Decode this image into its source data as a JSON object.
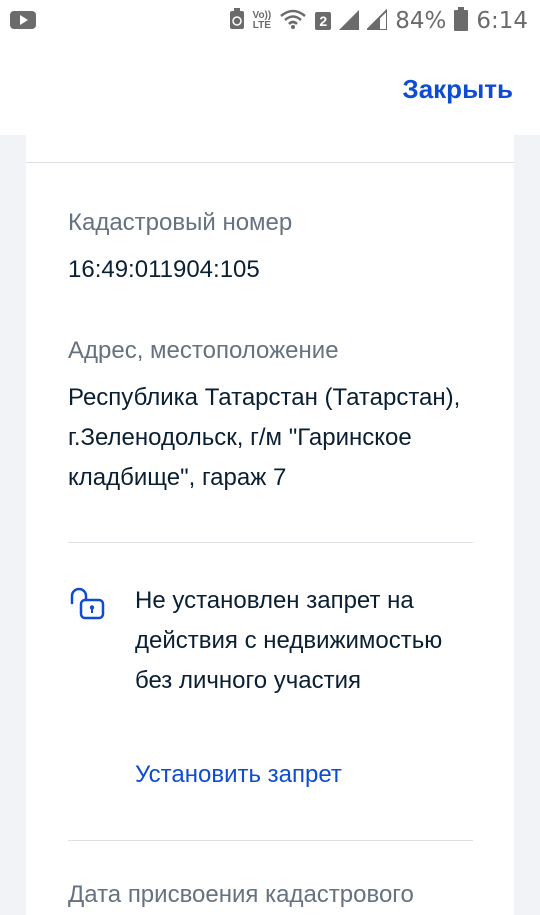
{
  "status_bar": {
    "battery": "84%",
    "time": "6:14",
    "network_label_1": "Vo))",
    "network_label_2": "LTE",
    "sim_badge": "2"
  },
  "header": {
    "close_label": "Закрыть"
  },
  "card": {
    "cadastral_label": "Кадастровый номер",
    "cadastral_value": "16:49:011904:105",
    "address_label": "Адрес, местоположение",
    "address_value": "Республика Татарстан (Татарстан), г.Зеленодольск, г/м \"Гаринское кладбище\", гараж 7",
    "ban_text": "Не установлен запрет на действия с недвижимостью без личного участия",
    "ban_link": "Установить запрет",
    "next_label": "Дата присвоения кадастрового"
  },
  "colors": {
    "accent": "#0d4cd3",
    "muted_text": "#66727f",
    "body_text": "#0b1f33"
  }
}
